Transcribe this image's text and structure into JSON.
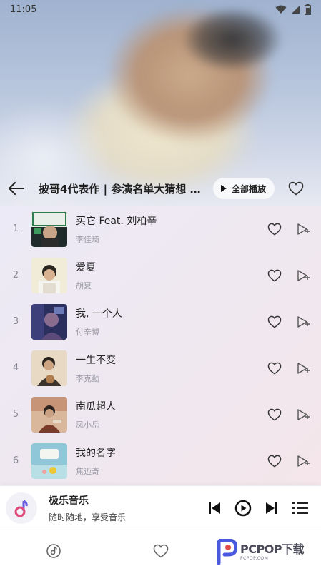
{
  "status_bar": {
    "time": "11:05"
  },
  "header": {
    "title": "披哥4代表作 | 参演名单大猜想 …",
    "play_all_label": "全部播放"
  },
  "songs": [
    {
      "index": "1",
      "title": "买它 Feat. 刘柏辛",
      "artist": "李佳琦"
    },
    {
      "index": "2",
      "title": "爱夏",
      "artist": "胡夏"
    },
    {
      "index": "3",
      "title": "我, 一个人",
      "artist": "付辛博"
    },
    {
      "index": "4",
      "title": "一生不变",
      "artist": "李克勤"
    },
    {
      "index": "5",
      "title": "南瓜超人",
      "artist": "凤小岳"
    },
    {
      "index": "6",
      "title": "我的名字",
      "artist": "焦迈奇"
    }
  ],
  "player": {
    "title": "极乐音乐",
    "subtitle": "随时随地，享受音乐"
  },
  "watermark": {
    "main": "PCPOP下载",
    "sub": "PCPOP.COM"
  },
  "colors": {
    "accent": "#5b4fe0",
    "text": "#222222",
    "muted": "#9a9aa6"
  }
}
